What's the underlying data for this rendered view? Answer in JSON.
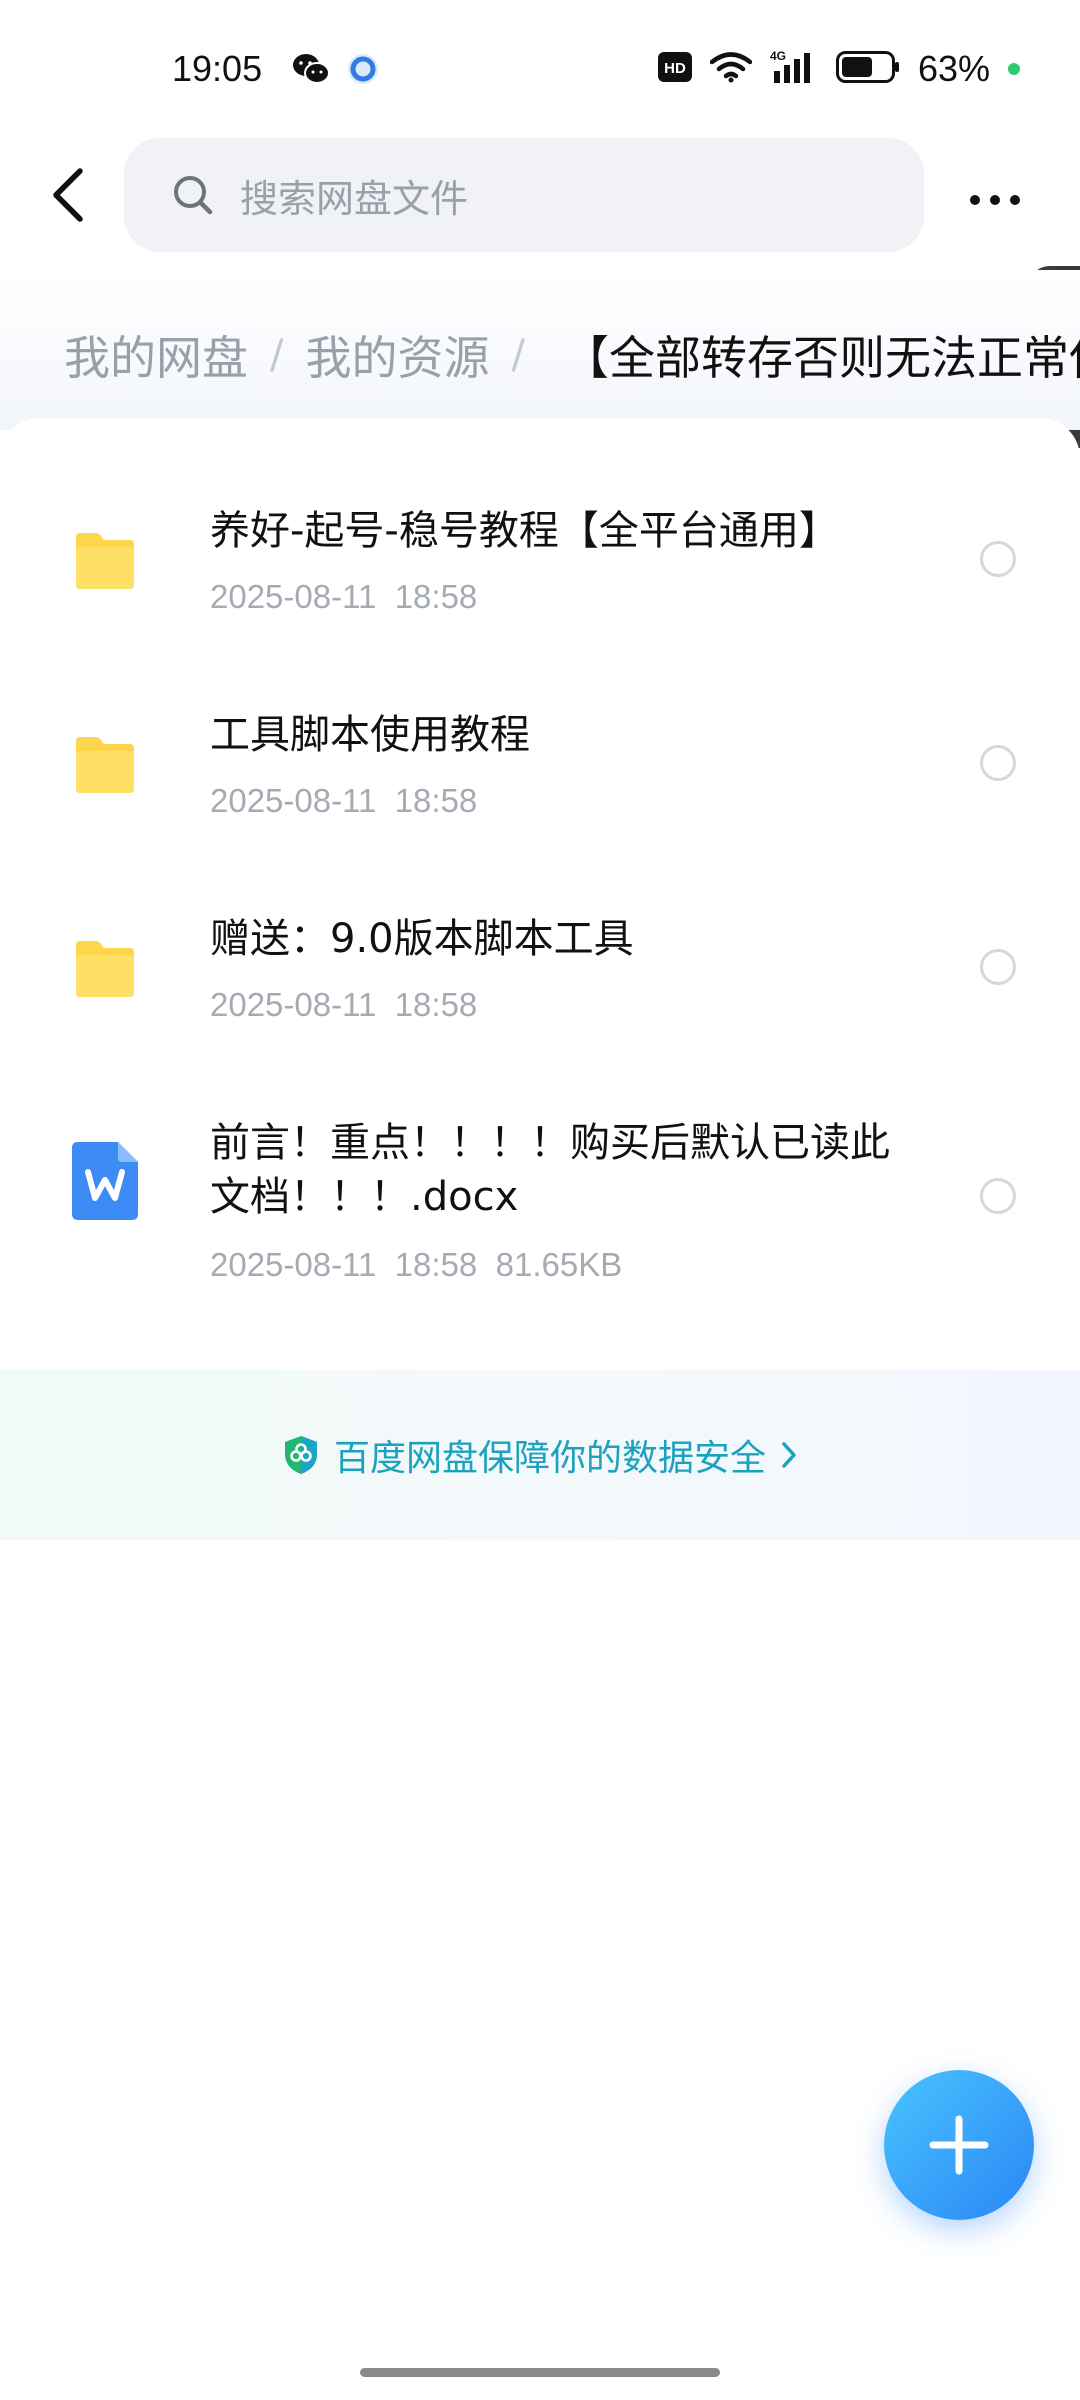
{
  "status_bar": {
    "time": "19:05",
    "battery_percent": "63%",
    "network_label": "4G",
    "hd_label": "HD",
    "charging_color": "#2ecc71",
    "app_icons": [
      "wechat-icon",
      "browser-icon"
    ]
  },
  "header": {
    "search_placeholder": "搜索网盘文件"
  },
  "breadcrumb": {
    "items": [
      "我的网盘",
      "我的资源"
    ],
    "current": "【全部转存否则无法正常使"
  },
  "files": [
    {
      "name": "养好-起号-稳号教程【全平台通用】",
      "type": "folder",
      "date": "2025-08-11",
      "time": "18:58",
      "size": ""
    },
    {
      "name": "工具脚本使用教程",
      "type": "folder",
      "date": "2025-08-11",
      "time": "18:58",
      "size": ""
    },
    {
      "name": "赠送：9.0版本脚本工具",
      "type": "folder",
      "date": "2025-08-11",
      "time": "18:58",
      "size": ""
    },
    {
      "name": "前言！重点！！！！购买后默认已读此文档！！！.docx",
      "type": "docx",
      "date": "2025-08-11",
      "time": "18:58",
      "size": "81.65KB"
    }
  ],
  "security_banner": {
    "text": "百度网盘保障你的数据安全"
  },
  "colors": {
    "folder": "#FDD64B",
    "docx": "#3D8BF5",
    "link": "#1aa2bf",
    "fab_start": "#49c4ff",
    "fab_end": "#2a86f5"
  }
}
